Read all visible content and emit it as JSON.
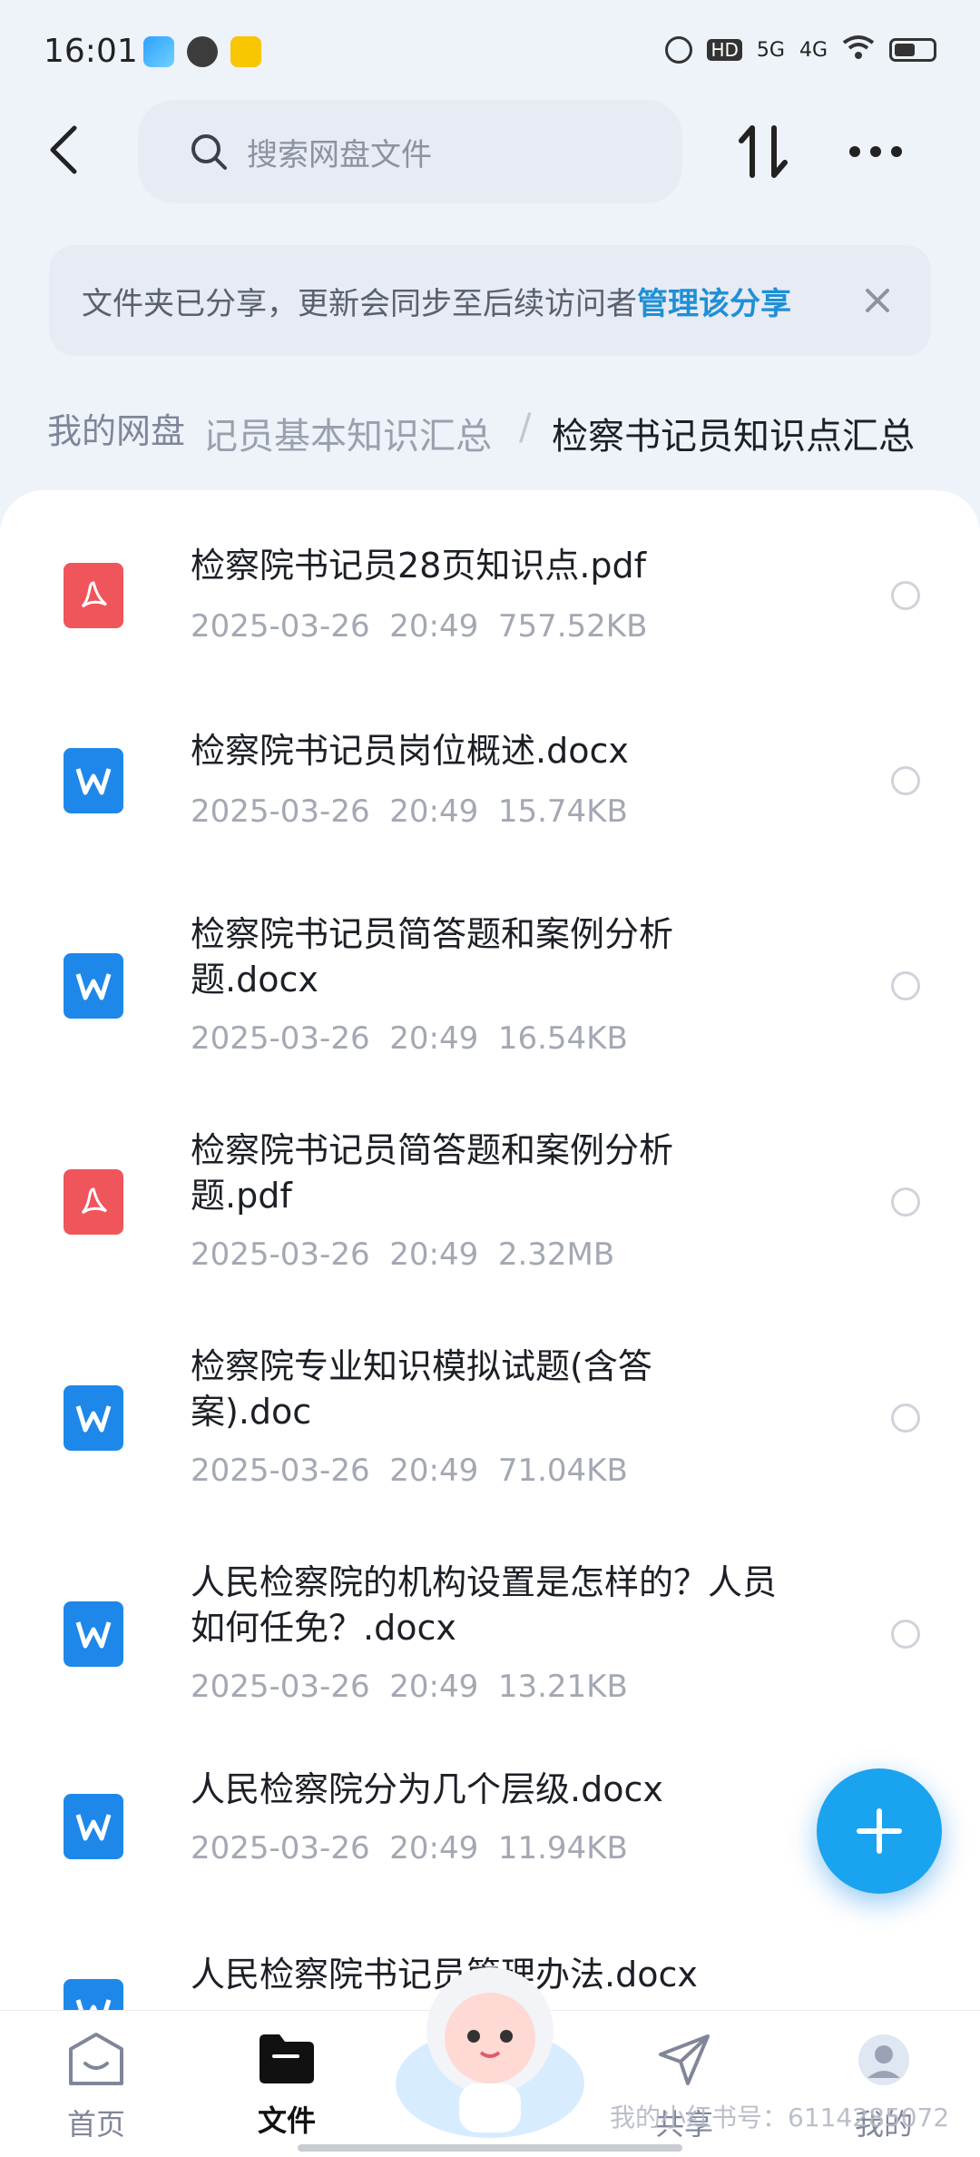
{
  "status_bar": {
    "time": "16:01",
    "network_1": "5G",
    "network_2": "4G"
  },
  "search": {
    "placeholder": "搜索网盘文件"
  },
  "banner": {
    "text": "文件夹已分享，更新会同步至后续访问者",
    "link": "管理该分享"
  },
  "breadcrumb": {
    "root": "我的网盘",
    "middle": "记员基本知识汇总",
    "separator": "/",
    "current": "检察书记员知识点汇总"
  },
  "files": [
    {
      "name": "检察院书记员28页知识点.pdf",
      "type": "pdf",
      "date": "2025-03-26",
      "time": "20:49",
      "size": "757.52KB"
    },
    {
      "name": "检察院书记员岗位概述.docx",
      "type": "doc",
      "date": "2025-03-26",
      "time": "20:49",
      "size": "15.74KB"
    },
    {
      "name": "检察院书记员简答题和案例分析题.docx",
      "type": "doc",
      "date": "2025-03-26",
      "time": "20:49",
      "size": "16.54KB"
    },
    {
      "name": "检察院书记员简答题和案例分析题.pdf",
      "type": "pdf",
      "date": "2025-03-26",
      "time": "20:49",
      "size": "2.32MB"
    },
    {
      "name": "检察院专业知识模拟试题(含答案).doc",
      "type": "doc",
      "date": "2025-03-26",
      "time": "20:49",
      "size": "71.04KB"
    },
    {
      "name": "人民检察院的机构设置是怎样的？人员如何任免？.docx",
      "type": "doc",
      "date": "2025-03-26",
      "time": "20:49",
      "size": "13.21KB"
    },
    {
      "name": "人民检察院分为几个层级.docx",
      "type": "doc",
      "date": "2025-03-26",
      "time": "20:49",
      "size": "11.94KB"
    },
    {
      "name": "人民检察院书记员管理办法.docx",
      "type": "doc",
      "date": "",
      "time": "",
      "size": ""
    }
  ],
  "nav": {
    "home": "首页",
    "files": "文件",
    "share": "共享",
    "mine": "我的"
  },
  "watermark": "我的小红书号：6114285072"
}
